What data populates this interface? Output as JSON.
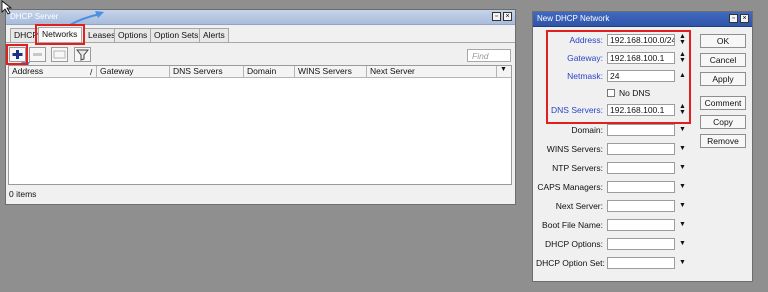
{
  "dhcp_window": {
    "title": "DHCP Server",
    "tabs": [
      "DHCP",
      "Networks",
      "Leases",
      "Options",
      "Option Sets",
      "Alerts"
    ],
    "find_placeholder": "Find",
    "columns": [
      "Address",
      "Gateway",
      "DNS Servers",
      "Domain",
      "WINS Servers",
      "Next Server"
    ],
    "sort_marker": "/",
    "status": "0 items"
  },
  "network_dialog": {
    "title": "New DHCP Network",
    "fields": [
      {
        "label": "Address:",
        "value": "192.168.100.0/24",
        "highlight": true
      },
      {
        "label": "Gateway:",
        "value": "192.168.100.1",
        "highlight": true
      },
      {
        "label": "Netmask:",
        "value": "24",
        "highlight": true
      },
      {
        "label": "DNS Servers:",
        "value": "192.168.100.1",
        "highlight": true
      },
      {
        "label": "Domain:",
        "value": "",
        "highlight": false
      },
      {
        "label": "WINS Servers:",
        "value": "",
        "highlight": false
      },
      {
        "label": "NTP Servers:",
        "value": "",
        "highlight": false
      },
      {
        "label": "CAPS Managers:",
        "value": "",
        "highlight": false
      },
      {
        "label": "Next Server:",
        "value": "",
        "highlight": false
      },
      {
        "label": "Boot File Name:",
        "value": "",
        "highlight": false
      },
      {
        "label": "DHCP Options:",
        "value": "",
        "highlight": false
      },
      {
        "label": "DHCP Option Set:",
        "value": "",
        "highlight": false
      }
    ],
    "no_dns_label": "No DNS",
    "buttons": [
      "OK",
      "Cancel",
      "Apply",
      "Comment",
      "Copy",
      "Remove"
    ]
  },
  "colors": {
    "highlight": "#e21f1f",
    "label_blue": "#2a44c8",
    "annotation_arrow": "#4a90e2",
    "titlebar_active": "#3a62b8"
  }
}
